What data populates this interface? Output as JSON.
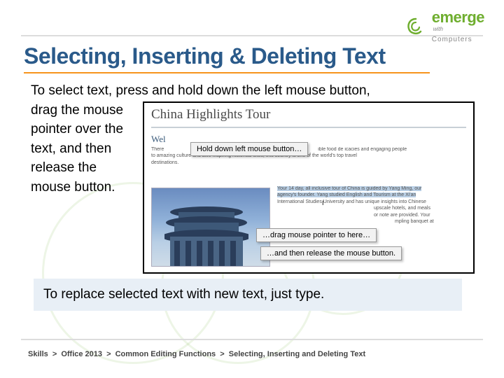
{
  "brand": {
    "wordmark": "emerge",
    "with": "with",
    "computers": "Computers"
  },
  "title": "Selecting, Inserting & Deleting Text",
  "body": {
    "line1": "To select text, press and hold down the left mouse button,",
    "line2": "drag the mouse",
    "line3": "pointer over the",
    "line4": "text, and then",
    "line5": "release the",
    "line6": "mouse button."
  },
  "figure": {
    "doc_title": "China Highlights Tour",
    "subheading": "Wel",
    "blurb1": "There",
    "blurb1b": "ible food de icacies and engaging people",
    "blurb2": "to amazing culture and awe-inspiring historical sites, this country is one of the world's top travel",
    "blurb3": "destinations.",
    "col2_a": "Your 14 day, all inclusive tour of China is guided by Yang Ming, our",
    "col2_b": "agency's founder. Yang studied English and Tourism at the Xi'an",
    "col2_c": "International Studies University and has unique insights into Chinese",
    "col2_d": "upscale hotels, and meals",
    "col2_e": "or note are provided. Your",
    "col2_f": "mpling banquet at",
    "tooltip1": "Hold down left mouse button…",
    "tooltip2": "…drag mouse pointer to here…",
    "tooltip3": "…and then release the mouse button.",
    "caret": "I"
  },
  "callout": "To replace selected text with new text, just type.",
  "breadcrumb": {
    "a": "Skills",
    "b": "Office 2013",
    "c": "Common Editing Functions",
    "d": "Selecting, Inserting and Deleting Text",
    "sep": ">"
  }
}
